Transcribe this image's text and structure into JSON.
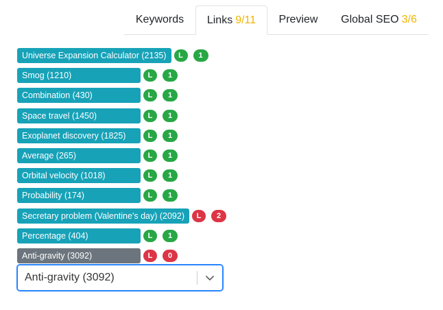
{
  "tabs": [
    {
      "label": "Keywords",
      "count": ""
    },
    {
      "label": "Links",
      "count": "9/11"
    },
    {
      "label": "Preview",
      "count": ""
    },
    {
      "label": "Global SEO",
      "count": "3/6"
    }
  ],
  "links": [
    {
      "label": "Universe Expansion Calculator (2135)",
      "flag": "L",
      "num": "1",
      "status": "ok"
    },
    {
      "label": "Smog (1210)",
      "flag": "L",
      "num": "1",
      "status": "ok"
    },
    {
      "label": "Combination (430)",
      "flag": "L",
      "num": "1",
      "status": "ok"
    },
    {
      "label": "Space travel (1450)",
      "flag": "L",
      "num": "1",
      "status": "ok"
    },
    {
      "label": "Exoplanet discovery (1825)",
      "flag": "L",
      "num": "1",
      "status": "ok"
    },
    {
      "label": "Average (265)",
      "flag": "L",
      "num": "1",
      "status": "ok"
    },
    {
      "label": "Orbital velocity (1018)",
      "flag": "L",
      "num": "1",
      "status": "ok"
    },
    {
      "label": "Probability (174)",
      "flag": "L",
      "num": "1",
      "status": "ok"
    },
    {
      "label": "Secretary problem (Valentine's day) (2092)",
      "flag": "L",
      "num": "2",
      "status": "bad"
    },
    {
      "label": "Percentage (404)",
      "flag": "L",
      "num": "1",
      "status": "ok"
    },
    {
      "label": "Anti-gravity (3092)",
      "flag": "L",
      "num": "0",
      "status": "inactive"
    }
  ],
  "select": {
    "value": "Anti-gravity (3092)"
  },
  "colors": {
    "teal": "#17a2b8",
    "gray": "#6c757d",
    "green": "#28a745",
    "red": "#dc3545",
    "accent": "#f0b400",
    "focus": "#2684ff"
  }
}
